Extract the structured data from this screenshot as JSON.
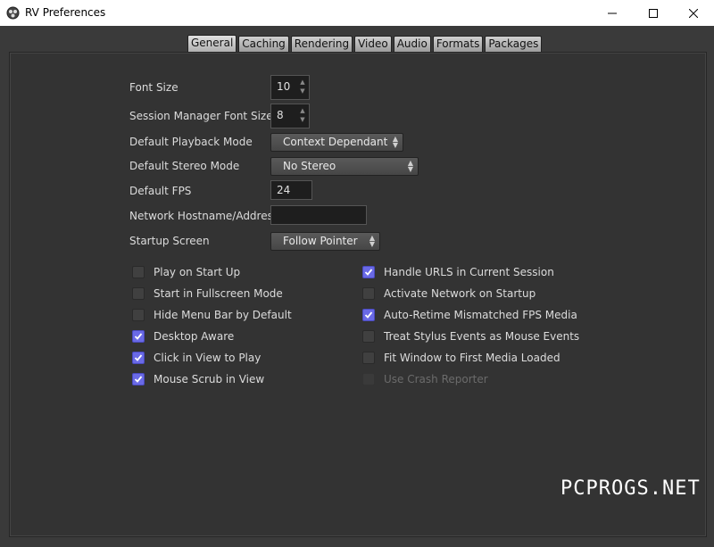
{
  "window": {
    "title": "RV Preferences"
  },
  "tabs": [
    "General",
    "Caching",
    "Rendering",
    "Video",
    "Audio",
    "Formats",
    "Packages"
  ],
  "general": {
    "font_size": {
      "label": "Font Size",
      "value": "10"
    },
    "session_font_size": {
      "label": "Session Manager Font Size",
      "value": "8"
    },
    "playback_mode": {
      "label": "Default Playback Mode",
      "value": "Context Dependant"
    },
    "stereo_mode": {
      "label": "Default Stereo Mode",
      "value": "No Stereo"
    },
    "fps": {
      "label": "Default FPS",
      "value": "24"
    },
    "network": {
      "label": "Network Hostname/Address",
      "value": ""
    },
    "startup_screen": {
      "label": "Startup Screen",
      "value": "Follow Pointer"
    }
  },
  "checkboxes_left": [
    {
      "label": "Play on Start Up",
      "checked": false
    },
    {
      "label": "Start in Fullscreen Mode",
      "checked": false
    },
    {
      "label": "Hide Menu Bar by Default",
      "checked": false
    },
    {
      "label": "Desktop Aware",
      "checked": true
    },
    {
      "label": "Click in View to Play",
      "checked": true
    },
    {
      "label": "Mouse Scrub in View",
      "checked": true
    }
  ],
  "checkboxes_right": [
    {
      "label": "Handle URLS in Current Session",
      "checked": true
    },
    {
      "label": "Activate Network on Startup",
      "checked": false
    },
    {
      "label": "Auto-Retime Mismatched FPS Media",
      "checked": true
    },
    {
      "label": "Treat Stylus Events as Mouse Events",
      "checked": false
    },
    {
      "label": "Fit Window to First Media Loaded",
      "checked": false
    },
    {
      "label": "Use Crash Reporter",
      "checked": false,
      "disabled": true
    }
  ],
  "watermark": "PCPROGS.NET"
}
